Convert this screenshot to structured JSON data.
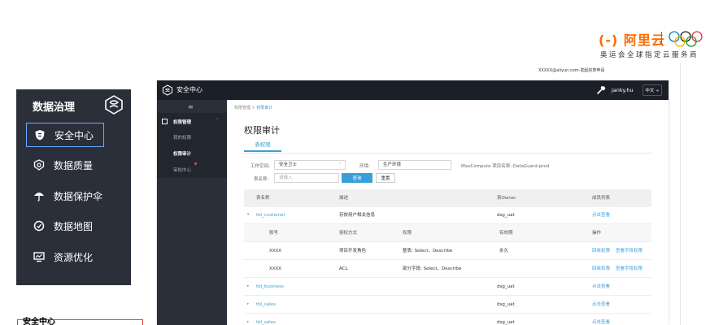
{
  "branding": {
    "logo_text": "(-) 阿里云",
    "subtitle": "奥运会全球指定云服务商",
    "caption": "XXXXX@aliyun.com-发起的表申请"
  },
  "left_menu": {
    "title": "数据治理",
    "items": [
      {
        "label": "安全中心",
        "icon": "shield-icon",
        "active": true
      },
      {
        "label": "数据质量",
        "icon": "quality-icon",
        "active": false
      },
      {
        "label": "数据保护伞",
        "icon": "umbrella-icon",
        "active": false
      },
      {
        "label": "数据地图",
        "icon": "map-icon",
        "active": false
      },
      {
        "label": "资源优化",
        "icon": "monitor-icon",
        "active": false
      }
    ]
  },
  "bottom_label": "安全中心",
  "app": {
    "title": "安全中心",
    "user": "janky.hu",
    "lang": "中文 ÷",
    "sidebar": {
      "hamburger": "≡",
      "group": "权限管理",
      "items": [
        "我的权限",
        "权限审计",
        "审批中心"
      ]
    },
    "breadcrumb": {
      "root": "权限管理",
      "sep": " > ",
      "current": "权限审计"
    },
    "page_title": "权限审计",
    "tab": "表权限",
    "filters": {
      "workspace_label": "工作空间:",
      "workspace_value": "安全卫士",
      "env_label": "环境:",
      "env_value": "生产环境",
      "project_text": "MaxCompute 项目名称: DataGuard-prod",
      "table_label": "表名称:",
      "table_placeholder": "请输入",
      "query_button": "查询",
      "reset_button": "重置"
    },
    "table": {
      "headers": [
        "表名称",
        "描述",
        "表Owner",
        "成员列表"
      ],
      "subheaders": [
        "账号",
        "授权方式",
        "权限",
        "有效期",
        "操作"
      ],
      "rows": [
        {
          "name": "tbl_customer",
          "desc": "存放用户相关信息",
          "owner": "dsg_uat",
          "action": "点击查看",
          "expanded": true
        },
        {
          "name": "tbl_business",
          "desc": "",
          "owner": "dsg_uat",
          "action": "点击查看",
          "expanded": false
        },
        {
          "name": "tbl_sales",
          "desc": "",
          "owner": "dsg_uat",
          "action": "点击查看",
          "expanded": false
        },
        {
          "name": "tbl_sales",
          "desc": "",
          "owner": "dsg_uat",
          "action": "点击查看",
          "expanded": false
        }
      ],
      "subrows": [
        {
          "account": "XXXX",
          "grant": "项目开发角色",
          "perm": "整表: Select、Describe",
          "validity": "永久",
          "op1": "回收权限",
          "op2": "查看字段权限"
        },
        {
          "account": "XXXX",
          "grant": "ACL",
          "perm": "部分字段: Select、Describe",
          "validity": "",
          "op1": "回收权限",
          "op2": "查看字段权限"
        }
      ]
    }
  },
  "colors": {
    "accent": "#3a9fd8",
    "dark_panel": "#2b2f3a",
    "topbar": "#1b1f27",
    "brand_orange": "#ff6a00"
  }
}
